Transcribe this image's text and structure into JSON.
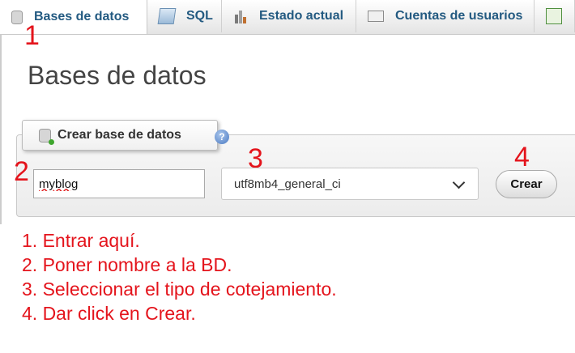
{
  "tabs": [
    {
      "label": "Bases de datos",
      "icon": "database-icon",
      "active": true
    },
    {
      "label": "SQL",
      "icon": "sql-icon",
      "active": false
    },
    {
      "label": "Estado actual",
      "icon": "status-chart-icon",
      "active": false
    },
    {
      "label": "Cuentas de usuarios",
      "icon": "user-accounts-icon",
      "active": false
    },
    {
      "label": "",
      "icon": "export-icon",
      "active": false
    }
  ],
  "page_title": "Bases de datos",
  "create_db": {
    "legend": "Crear base de datos",
    "name_value": "myblog",
    "collation_value": "utf8mb4_general_ci",
    "create_label": "Crear"
  },
  "annotations": {
    "step1": "1",
    "step2": "2",
    "step3": "3",
    "step4": "4"
  },
  "instructions": [
    "1. Entrar aquí.",
    "2. Poner nombre a la BD.",
    "3. Seleccionar el tipo de cotejamiento.",
    "4. Dar click en Crear."
  ],
  "colors": {
    "annotation": "#e4141c",
    "tab_text": "#235a81"
  }
}
